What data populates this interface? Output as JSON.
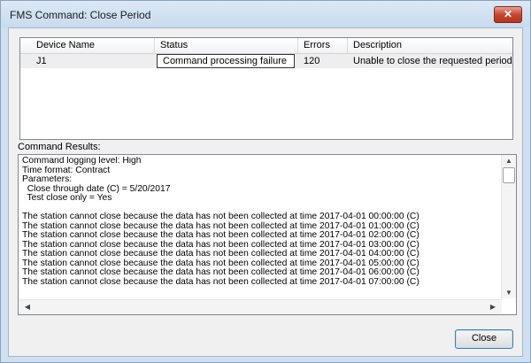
{
  "window": {
    "title": "FMS Command: Close Period",
    "close_glyph": "✕"
  },
  "list": {
    "columns": [
      "Device Name",
      "Status",
      "Errors",
      "Description"
    ],
    "rows": [
      {
        "device": "J1",
        "status": "Command processing failure",
        "errors": "120",
        "description": "Unable to close the requested period"
      }
    ]
  },
  "results": {
    "label": "Command Results:",
    "lines": [
      "Command logging level: High",
      "Time format: Contract",
      "Parameters:",
      "  Close through date (C) = 5/20/2017",
      "  Test close only = Yes",
      "",
      "The station cannot close because the data has not been collected at time 2017-04-01 00:00:00 (C)",
      "The station cannot close because the data has not been collected at time 2017-04-01 01:00:00 (C)",
      "The station cannot close because the data has not been collected at time 2017-04-01 02:00:00 (C)",
      "The station cannot close because the data has not been collected at time 2017-04-01 03:00:00 (C)",
      "The station cannot close because the data has not been collected at time 2017-04-01 04:00:00 (C)",
      "The station cannot close because the data has not been collected at time 2017-04-01 05:00:00 (C)",
      "The station cannot close because the data has not been collected at time 2017-04-01 06:00:00 (C)",
      "The station cannot close because the data has not been collected at time 2017-04-01 07:00:00 (C)"
    ]
  },
  "buttons": {
    "close_label": "Close"
  }
}
